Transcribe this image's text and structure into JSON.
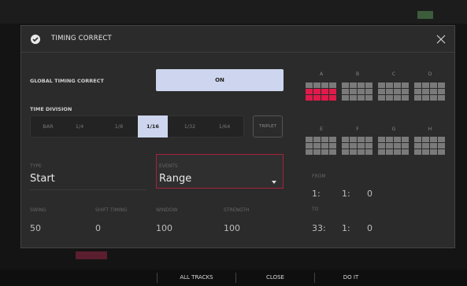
{
  "dialog": {
    "title": "TIMING CORRECT"
  },
  "global_timing_correct": {
    "label": "GLOBAL TIMING CORRECT",
    "value": "ON"
  },
  "time_division": {
    "label": "TIME DIVISION",
    "options": [
      "BAR",
      "1/4",
      "1/8",
      "1/16",
      "1/32",
      "1/64"
    ],
    "selected": "1/16",
    "triplet_label": "TRIPLET"
  },
  "type": {
    "label": "TYPE",
    "value": "Start"
  },
  "events": {
    "label": "EVENTS",
    "value": "Range"
  },
  "params": {
    "swing": {
      "label": "SWING",
      "value": "50"
    },
    "shift_timing": {
      "label": "SHIFT TIMING",
      "value": "0"
    },
    "window": {
      "label": "WINDOW",
      "value": "100"
    },
    "strength": {
      "label": "STRENGTH",
      "value": "100"
    }
  },
  "pad_banks": [
    {
      "name": "A",
      "active_pads": [
        4,
        5,
        6,
        7,
        8,
        9,
        10,
        11
      ]
    },
    {
      "name": "B",
      "active_pads": []
    },
    {
      "name": "C",
      "active_pads": []
    },
    {
      "name": "D",
      "active_pads": []
    },
    {
      "name": "E",
      "active_pads": []
    },
    {
      "name": "F",
      "active_pads": []
    },
    {
      "name": "G",
      "active_pads": []
    },
    {
      "name": "H",
      "active_pads": []
    }
  ],
  "range": {
    "from_label": "FROM",
    "from": [
      "1:",
      "1:",
      "0"
    ],
    "to_label": "TO",
    "to": [
      "33:",
      "1:",
      "0"
    ]
  },
  "bottom": {
    "all_tracks": "ALL TRACKS",
    "close": "CLOSE",
    "do_it": "DO IT"
  },
  "colors": {
    "accent": "#cdd6ee",
    "active_pad": "#e01a4a",
    "events_border": "#a6233b"
  }
}
